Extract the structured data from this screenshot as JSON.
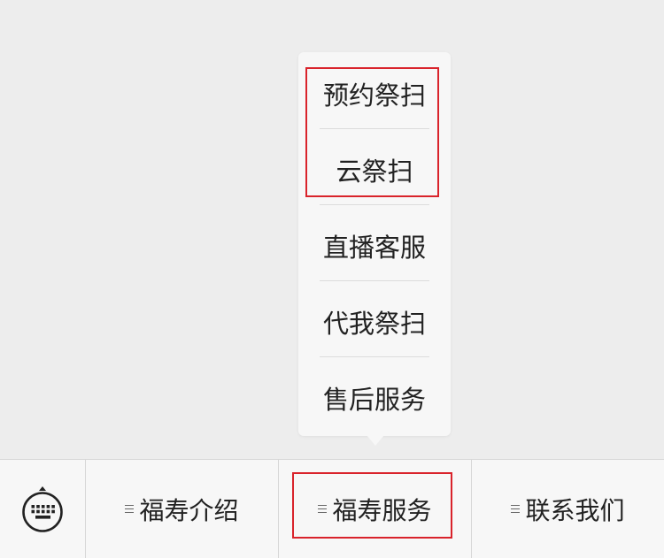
{
  "popup_menu": {
    "items": [
      {
        "label": "预约祭扫"
      },
      {
        "label": "云祭扫"
      },
      {
        "label": "直播客服"
      },
      {
        "label": "代我祭扫"
      },
      {
        "label": "售后服务"
      }
    ]
  },
  "bottom_menu": {
    "keyboard_icon": "keyboard-icon",
    "menu_icon": "menu-lines-icon",
    "tabs": [
      {
        "label": "福寿介绍"
      },
      {
        "label": "福寿服务"
      },
      {
        "label": "联系我们"
      }
    ]
  },
  "colors": {
    "highlight": "#d9232b",
    "background": "#ededed",
    "bar": "#f7f7f7"
  }
}
